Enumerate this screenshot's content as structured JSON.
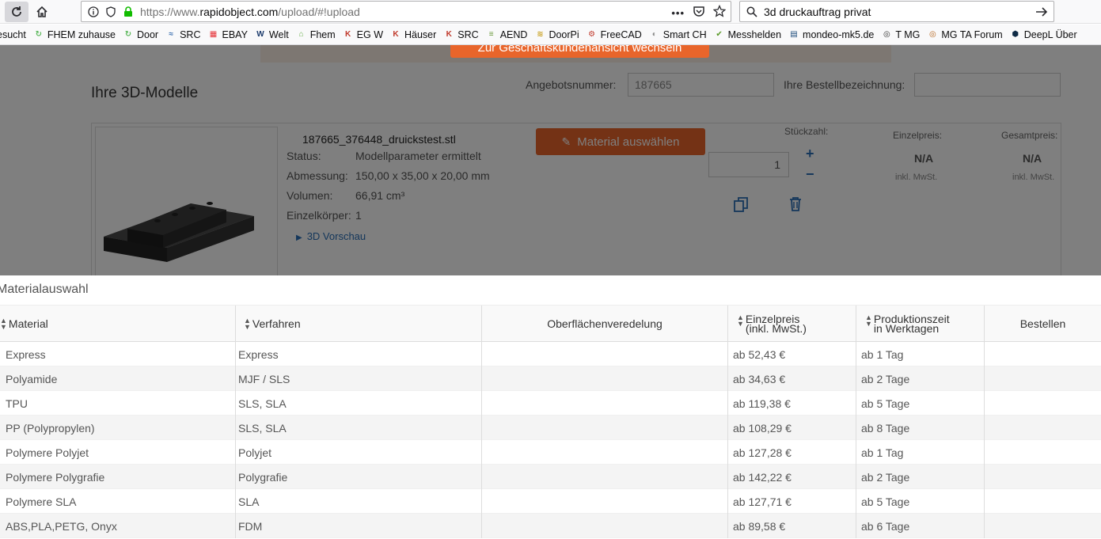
{
  "browser": {
    "url_prefix": "https://www.",
    "url_domain": "rapidobject.com",
    "url_path": "/upload/#!upload",
    "search_text": "3d druckauftrag privat",
    "more_label": "•••"
  },
  "bookmarks": [
    {
      "label": "esucht",
      "icon": "",
      "color": ""
    },
    {
      "label": "FHEM zuhause",
      "icon": "refresh-icon",
      "color": "#5cb85c"
    },
    {
      "label": "Door",
      "icon": "refresh-icon",
      "color": "#5cb85c"
    },
    {
      "label": "SRC",
      "icon": "src-icon",
      "color": "#3a6fb0"
    },
    {
      "label": "EBAY",
      "icon": "ebay-icon",
      "color": "#e53238"
    },
    {
      "label": "Welt",
      "icon": "w-icon",
      "color": "#1b3a6b"
    },
    {
      "label": "Fhem",
      "icon": "house-icon",
      "color": "#6ab04c"
    },
    {
      "label": "EG W",
      "icon": "k-icon",
      "color": "#c0392b"
    },
    {
      "label": "Häuser",
      "icon": "k-icon",
      "color": "#c0392b"
    },
    {
      "label": "SRC",
      "icon": "k-icon",
      "color": "#c0392b"
    },
    {
      "label": "AEND",
      "icon": "doc-icon",
      "color": "#6a9a3a"
    },
    {
      "label": "DoorPi",
      "icon": "doorpi-icon",
      "color": "#c8a020"
    },
    {
      "label": "FreeCAD",
      "icon": "freecad-icon",
      "color": "#c0392b"
    },
    {
      "label": "Smart CH",
      "icon": "circle-icon",
      "color": "#888888"
    },
    {
      "label": "Messhelden",
      "icon": "check-icon",
      "color": "#5a9a2a"
    },
    {
      "label": "mondeo-mk5.de",
      "icon": "bars-icon",
      "color": "#1b4a7a"
    },
    {
      "label": "T MG",
      "icon": "mg-icon",
      "color": "#333333"
    },
    {
      "label": "MG TA Forum",
      "icon": "mg-icon",
      "color": "#b5651d"
    },
    {
      "label": "DeepL Über",
      "icon": "deepl-icon",
      "color": "#0f2b46"
    }
  ],
  "page": {
    "top_button": "Zur Geschäftskundenansicht wechseln",
    "title": "Ihre 3D-Modelle",
    "offer_label": "Angebotsnummer:",
    "offer_value": "187665",
    "order_label": "Ihre Bestellbezeichnung:",
    "file_name": "187665_376448_druickstest.stl",
    "meta": [
      {
        "label": "Status:",
        "value": "Modellparameter ermittelt"
      },
      {
        "label": "Abmessung:",
        "value": "150,00 x 35,00 x 20,00 mm"
      },
      {
        "label": "Volumen:",
        "value": "66,91 cm³"
      },
      {
        "label": "Einzelkörper:",
        "value": "1"
      }
    ],
    "preview_link": "3D Vorschau",
    "material_button": "Material auswählen",
    "qty_label": "Stückzahl:",
    "qty_value": "1",
    "unit_price_label": "Einzelpreis:",
    "total_price_label": "Gesamtpreis:",
    "unit_price": "N/A",
    "total_price": "N/A",
    "vat_note": "inkl. MwSt."
  },
  "modal": {
    "title": "Materialauswahl",
    "columns": {
      "material": "Material",
      "process": "Verfahren",
      "surface": "Oberflächenveredelung",
      "price_l1": "Einzelpreis",
      "price_l2": "(inkl. MwSt.)",
      "time_l1": "Produktionszeit",
      "time_l2": "in Werktagen",
      "order": "Bestellen"
    },
    "rows": [
      {
        "material": "Express",
        "process": "Express",
        "price": "ab 52,43 €",
        "time": "ab 1 Tag"
      },
      {
        "material": "Polyamide",
        "process": "MJF / SLS",
        "price": "ab 34,63 €",
        "time": "ab 2 Tage"
      },
      {
        "material": "TPU",
        "process": "SLS, SLA",
        "price": "ab 119,38 €",
        "time": "ab 5 Tage"
      },
      {
        "material": "PP (Polypropylen)",
        "process": "SLS, SLA",
        "price": "ab 108,29 €",
        "time": "ab 8 Tage"
      },
      {
        "material": "Polymere Polyjet",
        "process": "Polyjet",
        "price": "ab 127,28 €",
        "time": "ab 1 Tag"
      },
      {
        "material": "Polymere Polygrafie",
        "process": "Polygrafie",
        "price": "ab 142,22 €",
        "time": "ab 2 Tage"
      },
      {
        "material": "Polymere SLA",
        "process": "SLA",
        "price": "ab 127,71 €",
        "time": "ab 5 Tage"
      },
      {
        "material": "ABS,PLA,PETG, Onyx",
        "process": "FDM",
        "price": "ab 89,58 €",
        "time": "ab 6 Tage"
      }
    ]
  }
}
